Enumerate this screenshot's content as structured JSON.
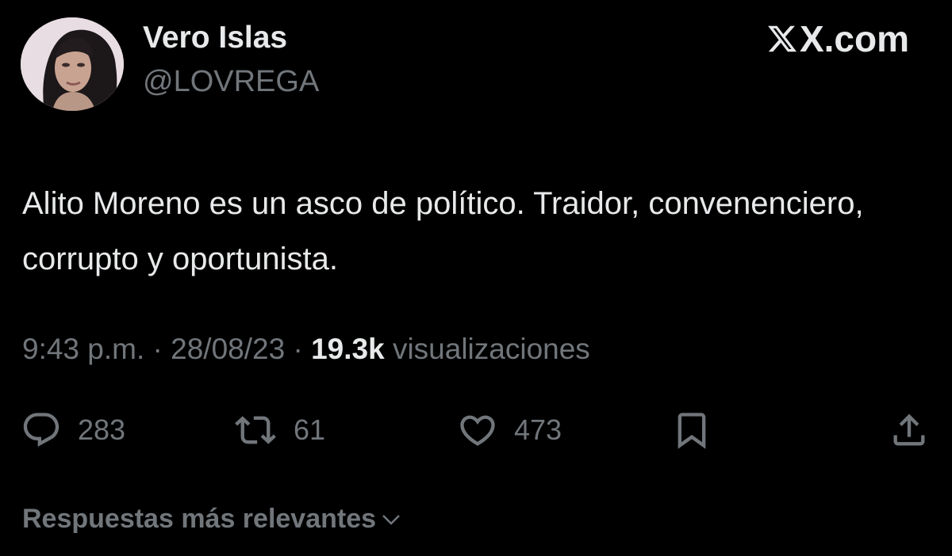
{
  "author": {
    "display_name": "Vero Islas",
    "handle": "@LOVREGA",
    "avatar_icon": "profile-photo"
  },
  "brand": {
    "label": "X.com",
    "icon": "x-logo-icon"
  },
  "tweet": {
    "text": "Alito Moreno es un asco de político. Traidor, convenenciero, corrupto y oportunista.",
    "time": "9:43 p.m.",
    "date": "28/08/23",
    "separator": "·",
    "views_count": "19.3k",
    "views_label": "visualizaciones"
  },
  "actions": {
    "reply": {
      "icon": "reply-icon",
      "count": "283"
    },
    "retweet": {
      "icon": "retweet-icon",
      "count": "61"
    },
    "like": {
      "icon": "heart-icon",
      "count": "473"
    },
    "bookmark": {
      "icon": "bookmark-icon"
    },
    "share": {
      "icon": "share-icon"
    }
  },
  "replies_sort": {
    "label": "Respuestas más relevantes",
    "icon": "chevron-down-icon"
  },
  "colors": {
    "background": "#000000",
    "primary_text": "#e7e9ea",
    "secondary_text": "#71767b"
  }
}
